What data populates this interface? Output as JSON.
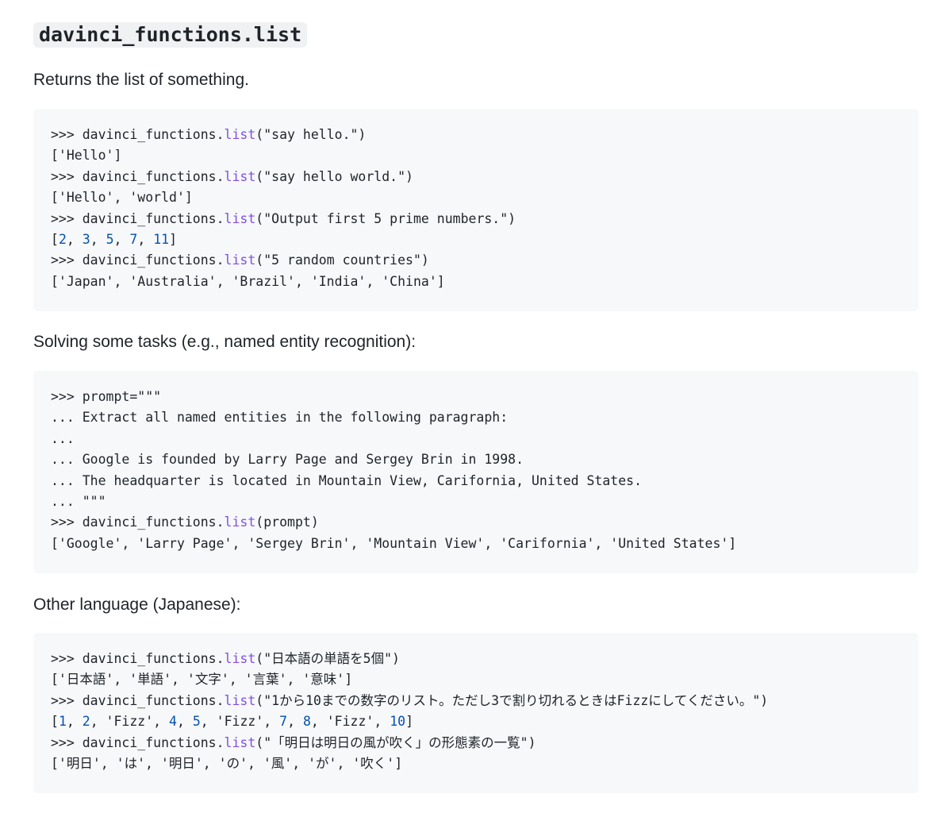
{
  "heading": "davinci_functions.list",
  "intro": "Returns the list of something.",
  "section2": "Solving some tasks (e.g., named entity recognition):",
  "section3": "Other language (Japanese):",
  "code_blocks": [
    [
      [
        [
          ">>> davinci_functions.",
          "plain"
        ],
        [
          "list",
          "fn"
        ],
        [
          "(\"say hello.\")",
          "plain"
        ]
      ],
      [
        [
          "['Hello']",
          "plain"
        ]
      ],
      [
        [
          ">>> davinci_functions.",
          "plain"
        ],
        [
          "list",
          "fn"
        ],
        [
          "(\"say hello world.\")",
          "plain"
        ]
      ],
      [
        [
          "['Hello', 'world']",
          "plain"
        ]
      ],
      [
        [
          ">>> davinci_functions.",
          "plain"
        ],
        [
          "list",
          "fn"
        ],
        [
          "(\"Output first 5 prime numbers.\")",
          "plain"
        ]
      ],
      [
        [
          "[",
          "plain"
        ],
        [
          "2",
          "num"
        ],
        [
          ", ",
          "plain"
        ],
        [
          "3",
          "num"
        ],
        [
          ", ",
          "plain"
        ],
        [
          "5",
          "num"
        ],
        [
          ", ",
          "plain"
        ],
        [
          "7",
          "num"
        ],
        [
          ", ",
          "plain"
        ],
        [
          "11",
          "num"
        ],
        [
          "]",
          "plain"
        ]
      ],
      [
        [
          ">>> davinci_functions.",
          "plain"
        ],
        [
          "list",
          "fn"
        ],
        [
          "(\"5 random countries\")",
          "plain"
        ]
      ],
      [
        [
          "['Japan', 'Australia', 'Brazil', 'India', 'China']",
          "plain"
        ]
      ]
    ],
    [
      [
        [
          ">>> prompt=\"\"\"",
          "plain"
        ]
      ],
      [
        [
          "... Extract all named entities in the following paragraph:",
          "plain"
        ]
      ],
      [
        [
          "...",
          "plain"
        ]
      ],
      [
        [
          "... Google is founded by Larry Page and Sergey Brin in 1998.",
          "plain"
        ]
      ],
      [
        [
          "... The headquarter is located in Mountain View, Carifornia, United States.",
          "plain"
        ]
      ],
      [
        [
          "... \"\"\"",
          "plain"
        ]
      ],
      [
        [
          ">>> davinci_functions.",
          "plain"
        ],
        [
          "list",
          "fn"
        ],
        [
          "(prompt)",
          "plain"
        ]
      ],
      [
        [
          "['Google', 'Larry Page', 'Sergey Brin', 'Mountain View', 'Carifornia', 'United States']",
          "plain"
        ]
      ]
    ],
    [
      [
        [
          ">>> davinci_functions.",
          "plain"
        ],
        [
          "list",
          "fn"
        ],
        [
          "(\"日本語の単語を5個\")",
          "plain"
        ]
      ],
      [
        [
          "['日本語', '単語', '文字', '言葉', '意味']",
          "plain"
        ]
      ],
      [
        [
          ">>> davinci_functions.",
          "plain"
        ],
        [
          "list",
          "fn"
        ],
        [
          "(\"1から10までの数字のリスト。ただし3で割り切れるときはFizzにしてください。\")",
          "plain"
        ]
      ],
      [
        [
          "[",
          "plain"
        ],
        [
          "1",
          "num"
        ],
        [
          ", ",
          "plain"
        ],
        [
          "2",
          "num"
        ],
        [
          ", 'Fizz', ",
          "plain"
        ],
        [
          "4",
          "num"
        ],
        [
          ", ",
          "plain"
        ],
        [
          "5",
          "num"
        ],
        [
          ", 'Fizz', ",
          "plain"
        ],
        [
          "7",
          "num"
        ],
        [
          ", ",
          "plain"
        ],
        [
          "8",
          "num"
        ],
        [
          ", 'Fizz', ",
          "plain"
        ],
        [
          "10",
          "num"
        ],
        [
          "]",
          "plain"
        ]
      ],
      [
        [
          ">>> davinci_functions.",
          "plain"
        ],
        [
          "list",
          "fn"
        ],
        [
          "(\"「明日は明日の風が吹く」の形態素の一覧\")",
          "plain"
        ]
      ],
      [
        [
          "['明日', 'は', '明日', 'の', '風', 'が', '吹く']",
          "plain"
        ]
      ]
    ]
  ]
}
